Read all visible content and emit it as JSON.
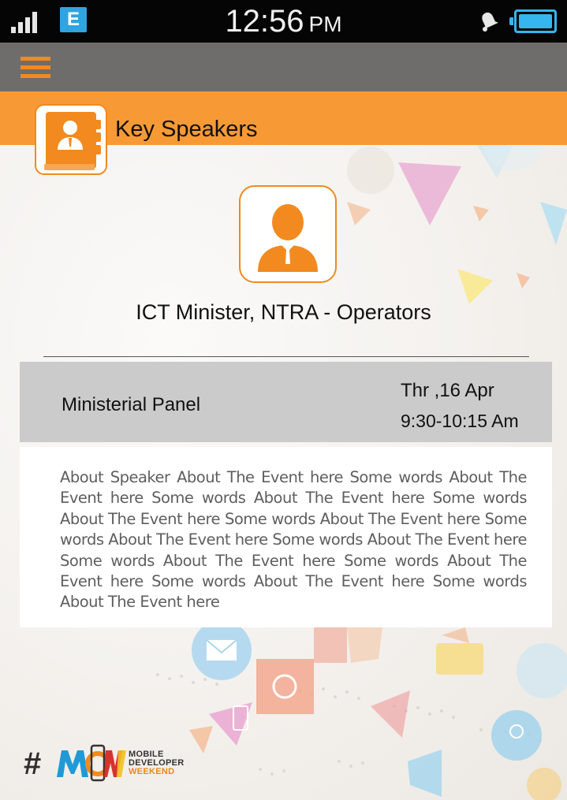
{
  "status_bar": {
    "network_badge": "E",
    "time": "12:56",
    "ampm": "PM",
    "icons": [
      "signal-bars-icon",
      "network-e-icon",
      "bell-icon",
      "battery-icon"
    ]
  },
  "nav": {
    "menu_icon": "hamburger-menu-icon"
  },
  "header": {
    "title": "Key Speakers",
    "icon": "address-book-icon"
  },
  "speaker": {
    "avatar_icon": "person-avatar-icon",
    "name": "ICT Minister, NTRA - Operators"
  },
  "session": {
    "title": "Ministerial Panel",
    "date": "Thr ,16 Apr",
    "time": "9:30-10:15 Am"
  },
  "about": {
    "text": "About Speaker      About The Event here  Some words  About The Event here  Some words  About The Event here  Some words About The Event here  Some words  About The Event here  Some words  About The Event here  Some words  About The Event here  Some words  About The Event here  Some words  About The Event here  Some words  About The Event here  Some words  About The Event here"
  },
  "footer": {
    "hash": "#",
    "logo_lines": [
      "MOBILE",
      "DEVELOPER",
      "WEEKEND"
    ]
  },
  "colors": {
    "accent_orange": "#f79a36",
    "icon_orange": "#f28a1f",
    "status_bar": "#050505",
    "nav_bar": "#6e6d6c",
    "session_bar": "#cbcbcb",
    "battery_blue": "#35b6ef",
    "badge_blue": "#2fa4e0"
  }
}
